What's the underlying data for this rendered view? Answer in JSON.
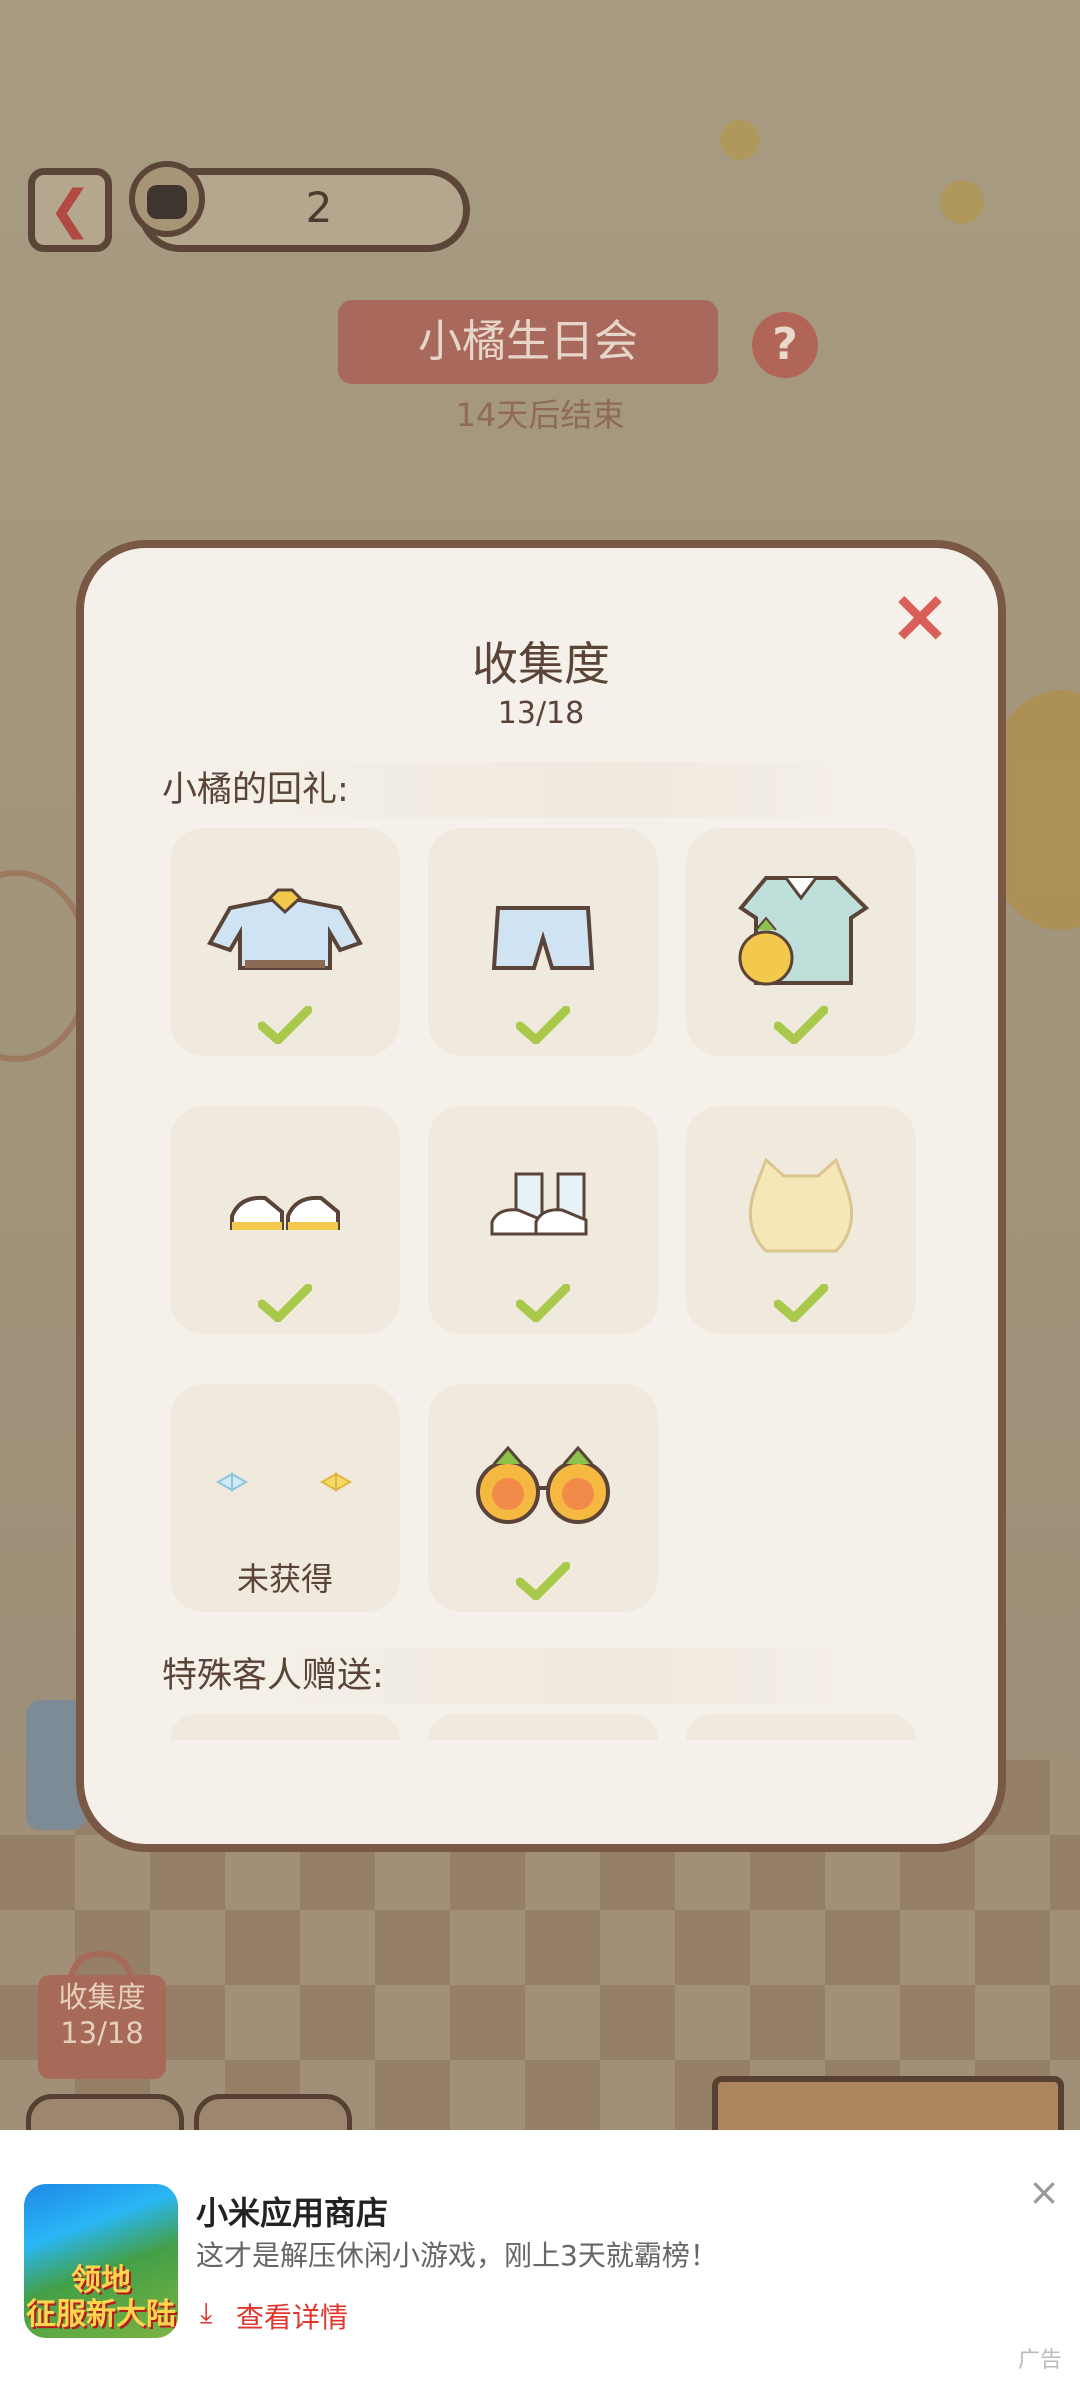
{
  "header": {
    "counter_value": "2",
    "event_title": "小橘生日会",
    "event_subtitle": "14天后结束",
    "help_label": "?"
  },
  "background_badge": {
    "label": "收集度",
    "count": "13/18"
  },
  "modal": {
    "title": "收集度",
    "count": "13/18",
    "close_label": "×",
    "section_gifts": "小橘的回礼:",
    "section_special": "特殊客人赠送:",
    "items": [
      {
        "name": "jacket-with-bow",
        "obtained": true
      },
      {
        "name": "blue-shorts",
        "obtained": true
      },
      {
        "name": "pineapple-dress",
        "obtained": true
      },
      {
        "name": "white-yellow-shoes",
        "obtained": true
      },
      {
        "name": "socks-with-shoes",
        "obtained": true
      },
      {
        "name": "cat-ear-hair",
        "obtained": true
      },
      {
        "name": "hair-bows",
        "obtained": false,
        "status": "未获得"
      },
      {
        "name": "pineapple-glasses",
        "obtained": true
      }
    ]
  },
  "ad": {
    "title": "小米应用商店",
    "description": "这才是解压休闲小游戏，刚上3天就霸榜！",
    "link_label": "查看详情",
    "icon_text": "领地\n征服新大陆",
    "close_label": "×",
    "badge": "广告"
  },
  "colors": {
    "accent_red": "#d95f58",
    "check_green": "#a9c94a",
    "modal_border": "#7a5846"
  }
}
